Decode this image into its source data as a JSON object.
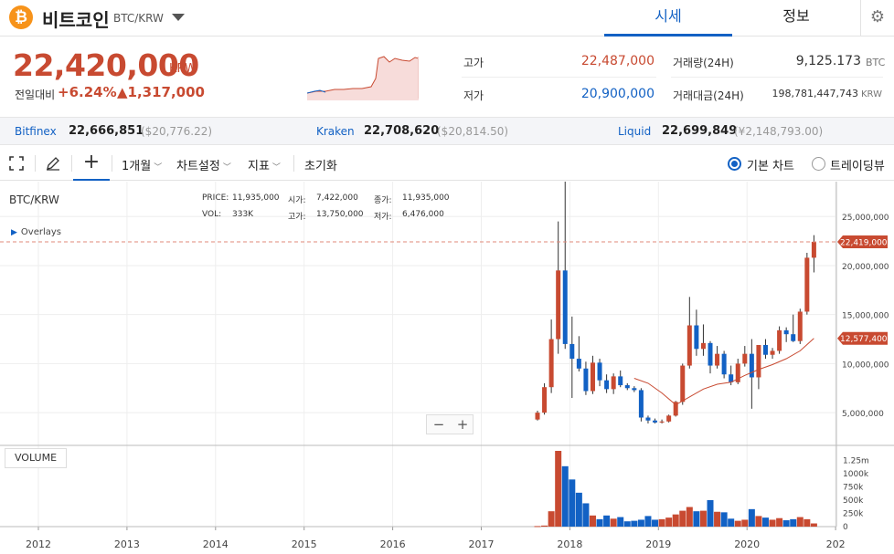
{
  "header": {
    "coin_logo": "₿",
    "coin_name": "비트코인",
    "pair": "BTC/KRW",
    "tabs": [
      {
        "label": "시세",
        "active": true
      },
      {
        "label": "정보",
        "active": false
      }
    ],
    "settings_icon": "gear-icon"
  },
  "price": {
    "current": "22,420,000",
    "unit": "KRW",
    "prev_label": "전일대비",
    "change_rate": "+6.24%",
    "change_amount": "▲1,317,000"
  },
  "stats": [
    {
      "label": "고가",
      "value": "22,487,000",
      "color": "#c84a31"
    },
    {
      "label": "저가",
      "value": "20,900,000",
      "color": "#1261c4"
    },
    {
      "label": "거래량(24H)",
      "value": "9,125.173",
      "unit": "BTC"
    },
    {
      "label": "거래대금(24H)",
      "value": "198,781,447,743",
      "unit": "KRW"
    }
  ],
  "exchanges": [
    {
      "name": "Bitfinex",
      "price": "22,666,851",
      "usd": "($20,776.22)"
    },
    {
      "name": "Kraken",
      "price": "22,708,620",
      "usd": "($20,814.50)"
    },
    {
      "name": "Liquid",
      "price": "22,699,849",
      "usd": "(¥2,148,793.00)"
    }
  ],
  "toolbar": {
    "period": "1개월",
    "chart_settings": "차트설정",
    "indicators": "지표",
    "reset": "초기화",
    "basic_chart": "기본 차트",
    "tradingview": "트레이딩뷰"
  },
  "chart_info": {
    "ticker": "BTC/KRW",
    "price_label": "PRICE:",
    "price": "11,935,000",
    "vol_label": "VOL:",
    "vol": "333K",
    "open_label": "시가:",
    "open": "7,422,000",
    "high_label": "고가:",
    "high": "13,750,000",
    "close_label": "종가:",
    "close": "11,935,000",
    "low_label": "저가:",
    "low": "6,476,000",
    "overlays": "Overlays",
    "volume_label": "VOLUME",
    "last_price_tag": "22,419,000",
    "ma_tag": "12,577,400"
  },
  "colors": {
    "up": "#c84a31",
    "down": "#1261c4",
    "accent": "#1261c4"
  },
  "chart_data": {
    "type": "candlestick",
    "x_axis_ticks": [
      "2012",
      "2013",
      "2014",
      "2015",
      "2016",
      "2017",
      "2018",
      "2019",
      "2020",
      "202"
    ],
    "y_axis_ticks": [
      "25,000,000",
      "20,000,000",
      "15,000,000",
      "10,000,000",
      "5,000,000"
    ],
    "y_axis_values": [
      25000000,
      20000000,
      15000000,
      10000000,
      5000000
    ],
    "volume_axis_ticks": [
      "1.25m",
      "1000k",
      "750k",
      "500k",
      "250k",
      "0"
    ],
    "volume_axis_values": [
      1250000,
      1000000,
      750000,
      500000,
      250000,
      0
    ],
    "ylim": [
      2500000,
      28000000
    ],
    "candles": [
      {
        "o": 4300000,
        "h": 5200000,
        "l": 4200000,
        "c": 5000000,
        "v": 10000
      },
      {
        "o": 5000000,
        "h": 8000000,
        "l": 4800000,
        "c": 7600000,
        "v": 20000
      },
      {
        "o": 7600000,
        "h": 14500000,
        "l": 7000000,
        "c": 12500000,
        "v": 290000
      },
      {
        "o": 12500000,
        "h": 24500000,
        "l": 11000000,
        "c": 19500000,
        "v": 1430000
      },
      {
        "o": 19500000,
        "h": 28800000,
        "l": 11500000,
        "c": 12000000,
        "v": 1140000
      },
      {
        "o": 12000000,
        "h": 14800000,
        "l": 6500000,
        "c": 10500000,
        "v": 890000
      },
      {
        "o": 10500000,
        "h": 12800000,
        "l": 9200000,
        "c": 9500000,
        "v": 640000
      },
      {
        "o": 9500000,
        "h": 10200000,
        "l": 6800000,
        "c": 7200000,
        "v": 440000
      },
      {
        "o": 7200000,
        "h": 10800000,
        "l": 6900000,
        "c": 10100000,
        "v": 210000
      },
      {
        "o": 10100000,
        "h": 10500000,
        "l": 7700000,
        "c": 8300000,
        "v": 140000
      },
      {
        "o": 8300000,
        "h": 8900000,
        "l": 7000000,
        "c": 7400000,
        "v": 210000
      },
      {
        "o": 7400000,
        "h": 9000000,
        "l": 6900000,
        "c": 8700000,
        "v": 150000
      },
      {
        "o": 8700000,
        "h": 9300000,
        "l": 7600000,
        "c": 7800000,
        "v": 180000
      },
      {
        "o": 7800000,
        "h": 8000000,
        "l": 7300000,
        "c": 7500000,
        "v": 100000
      },
      {
        "o": 7500000,
        "h": 7700000,
        "l": 7100000,
        "c": 7300000,
        "v": 110000
      },
      {
        "o": 7300000,
        "h": 7500000,
        "l": 4100000,
        "c": 4500000,
        "v": 130000
      },
      {
        "o": 4500000,
        "h": 4700000,
        "l": 3900000,
        "c": 4200000,
        "v": 200000
      },
      {
        "o": 4200000,
        "h": 4400000,
        "l": 3900000,
        "c": 4000000,
        "v": 130000
      },
      {
        "o": 4000000,
        "h": 4300000,
        "l": 3900000,
        "c": 4100000,
        "v": 140000
      },
      {
        "o": 4100000,
        "h": 4800000,
        "l": 4000000,
        "c": 4700000,
        "v": 170000
      },
      {
        "o": 4700000,
        "h": 6200000,
        "l": 4600000,
        "c": 6100000,
        "v": 230000
      },
      {
        "o": 6100000,
        "h": 10000000,
        "l": 5800000,
        "c": 9800000,
        "v": 300000
      },
      {
        "o": 9800000,
        "h": 16800000,
        "l": 9500000,
        "c": 13900000,
        "v": 370000
      },
      {
        "o": 13900000,
        "h": 15500000,
        "l": 10800000,
        "c": 11500000,
        "v": 290000
      },
      {
        "o": 11500000,
        "h": 14000000,
        "l": 10800000,
        "c": 12100000,
        "v": 300000
      },
      {
        "o": 12100000,
        "h": 12300000,
        "l": 9000000,
        "c": 9800000,
        "v": 500000
      },
      {
        "o": 9800000,
        "h": 11800000,
        "l": 9500000,
        "c": 11000000,
        "v": 280000
      },
      {
        "o": 11000000,
        "h": 11300000,
        "l": 8500000,
        "c": 8900000,
        "v": 270000
      },
      {
        "o": 8900000,
        "h": 9800000,
        "l": 7800000,
        "c": 8100000,
        "v": 150000
      },
      {
        "o": 8100000,
        "h": 10500000,
        "l": 7900000,
        "c": 10000000,
        "v": 110000
      },
      {
        "o": 10000000,
        "h": 11800000,
        "l": 9700000,
        "c": 11000000,
        "v": 130000
      },
      {
        "o": 11000000,
        "h": 12500000,
        "l": 5400000,
        "c": 8600000,
        "v": 330000
      },
      {
        "o": 8600000,
        "h": 11900000,
        "l": 7400000,
        "c": 11900000,
        "v": 200000
      },
      {
        "o": 11900000,
        "h": 12500000,
        "l": 10500000,
        "c": 10900000,
        "v": 170000
      },
      {
        "o": 10900000,
        "h": 11600000,
        "l": 10500000,
        "c": 11300000,
        "v": 130000
      },
      {
        "o": 11300000,
        "h": 13800000,
        "l": 11000000,
        "c": 13400000,
        "v": 160000
      },
      {
        "o": 13400000,
        "h": 13700000,
        "l": 12200000,
        "c": 13000000,
        "v": 120000
      },
      {
        "o": 13000000,
        "h": 15000000,
        "l": 12200000,
        "c": 12300000,
        "v": 140000
      },
      {
        "o": 12300000,
        "h": 15600000,
        "l": 12000000,
        "c": 15300000,
        "v": 180000
      },
      {
        "o": 15300000,
        "h": 21300000,
        "l": 15000000,
        "c": 20800000,
        "v": 140000
      },
      {
        "o": 20800000,
        "h": 23100000,
        "l": 19300000,
        "c": 22419000,
        "v": 60000
      }
    ],
    "moving_average": [
      {
        "i": 14,
        "v": 8500000
      },
      {
        "i": 16,
        "v": 8000000
      },
      {
        "i": 18,
        "v": 7000000
      },
      {
        "i": 20,
        "v": 5800000
      },
      {
        "i": 22,
        "v": 6600000
      },
      {
        "i": 24,
        "v": 7400000
      },
      {
        "i": 26,
        "v": 7900000
      },
      {
        "i": 28,
        "v": 8100000
      },
      {
        "i": 30,
        "v": 8800000
      },
      {
        "i": 32,
        "v": 9400000
      },
      {
        "i": 34,
        "v": 9900000
      },
      {
        "i": 36,
        "v": 10500000
      },
      {
        "i": 38,
        "v": 11300000
      },
      {
        "i": 40,
        "v": 12577400
      }
    ]
  }
}
